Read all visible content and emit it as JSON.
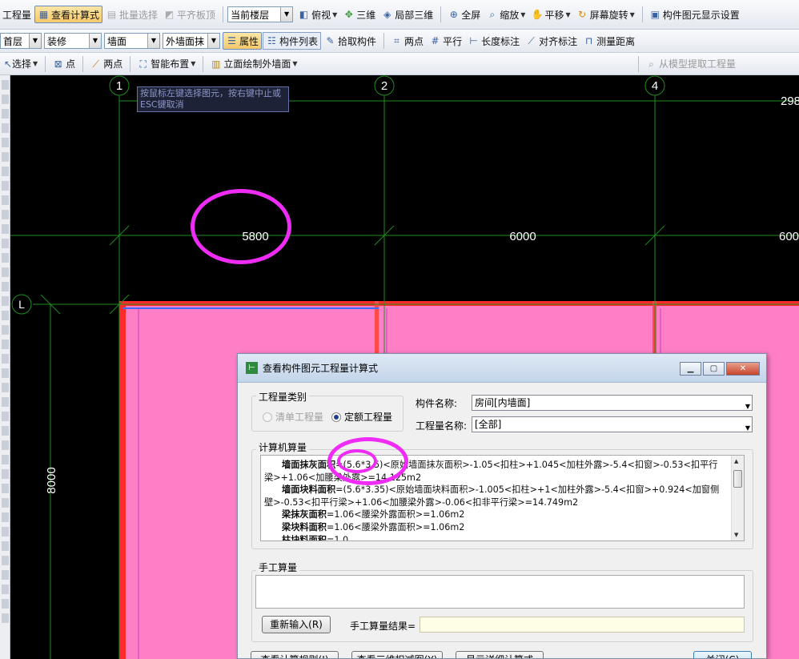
{
  "toolbar1": {
    "items": [
      {
        "label": "工程量",
        "state": "normal"
      },
      {
        "label": "查看计算式",
        "state": "pressed"
      },
      {
        "label": "批量选择",
        "state": "disabled"
      },
      {
        "label": "平齐板顶",
        "state": "disabled"
      }
    ],
    "floor_combo": "当前楼层",
    "views": [
      "俯视",
      "三维",
      "局部三维",
      "全屏",
      "缩放",
      "平移",
      "屏幕旋转",
      "构件图元显示设置"
    ]
  },
  "toolbar2": {
    "combos": [
      "首层",
      "装修",
      "墙面",
      "外墙面抹"
    ],
    "properties_label": "属性",
    "component_list_label": "构件列表",
    "pick_label": "拾取构件",
    "tools": [
      "两点",
      "平行",
      "长度标注",
      "对齐标注",
      "测量距离"
    ]
  },
  "toolbar3": {
    "select_label": "选择",
    "point_label": "点",
    "two_point_label": "两点",
    "smart_layout_label": "智能布置",
    "facade_label": "立面绘制外墙面",
    "extract_label": "从模型提取工程量"
  },
  "canvas": {
    "tooltip": "按鼠标左键选择图元，按右键中止或ESC键取消",
    "axis_labels": [
      "1",
      "2",
      "4",
      "L"
    ],
    "dimensions": [
      "5800",
      "6000",
      "600",
      "298",
      "8000"
    ],
    "colors": {
      "background": "#000000",
      "grid": "#1f8c1f",
      "room_fill": "#ff7fc7",
      "wall_red": "#ff2a2a",
      "annotation": "#ef2cf5"
    }
  },
  "dialog": {
    "title": "查看构件图元工程量计算式",
    "qty_type_label": "工程量类别",
    "radio_bill": "清单工程量",
    "radio_quota": "定额工程量",
    "selected_radio": "定额工程量",
    "component_name_label": "构件名称:",
    "component_name_value": "房间[内墙面]",
    "qty_name_label": "工程量名称:",
    "qty_name_value": "[全部]",
    "calc_section_label": "计算机算量",
    "calc_lines": [
      {
        "name": "墙面抹灰面积",
        "text": "=(5.6*3.5)<原始墙面抹灰面积>-1.05<扣柱>+1.045<加柱外露>-5.4<扣窗>-0.53<扣平行"
      },
      {
        "name": "",
        "text": "梁>+1.06<加腰梁外露>=14.125m2"
      },
      {
        "name": "墙面块料面积",
        "text": "=(5.6*3.35)<原始墙面块料面积>-1.005<扣柱>+1<加柱外露>-5.4<扣窗>+0.924<加窗侧"
      },
      {
        "name": "",
        "text": "壁>-0.53<扣平行梁>+1.06<加腰梁外露>-0.06<扣非平行梁>=14.749m2"
      },
      {
        "name": "梁抹灰面积",
        "text": "=1.06<腰梁外露面积>=1.06m2"
      },
      {
        "name": "梁块料面积",
        "text": "=1.06<腰梁外露面积>=1.06m2"
      },
      {
        "name": "柱块料面积",
        "text": "=1.0"
      }
    ],
    "manual_section_label": "手工算量",
    "reenter_button": "重新输入(R)",
    "manual_result_label": "手工算量结果=",
    "bottom_buttons": [
      "查看计算规则(J)",
      "查看三维扣减图(Y)",
      "显示详细计算式",
      "关闭(C)"
    ]
  }
}
